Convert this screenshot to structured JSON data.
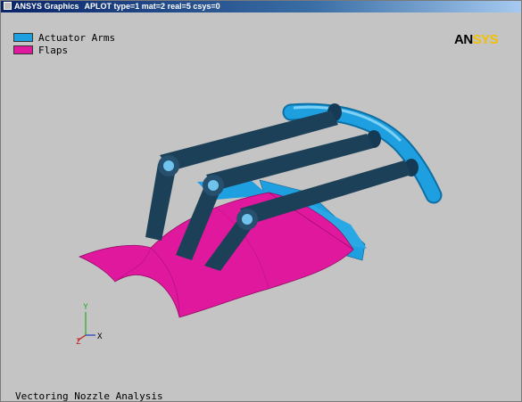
{
  "window": {
    "title": "ANSYS Graphics",
    "subtitle": "APLOT  type=1 mat=2 real=5 csys=0"
  },
  "legend": [
    {
      "label": "Actuator Arms",
      "color": "#1e9fe0"
    },
    {
      "label": "Flaps",
      "color": "#e0189e"
    }
  ],
  "logo": {
    "part1": "AN",
    "part2": "SYS"
  },
  "caption": "Vectoring Nozzle Analysis",
  "triad": {
    "x_label": "X"
  },
  "colors": {
    "background": "#c4c4c4",
    "arms": "#1e9fe0",
    "arms_dark": "#1a3a4e",
    "flaps": "#e0189e"
  }
}
